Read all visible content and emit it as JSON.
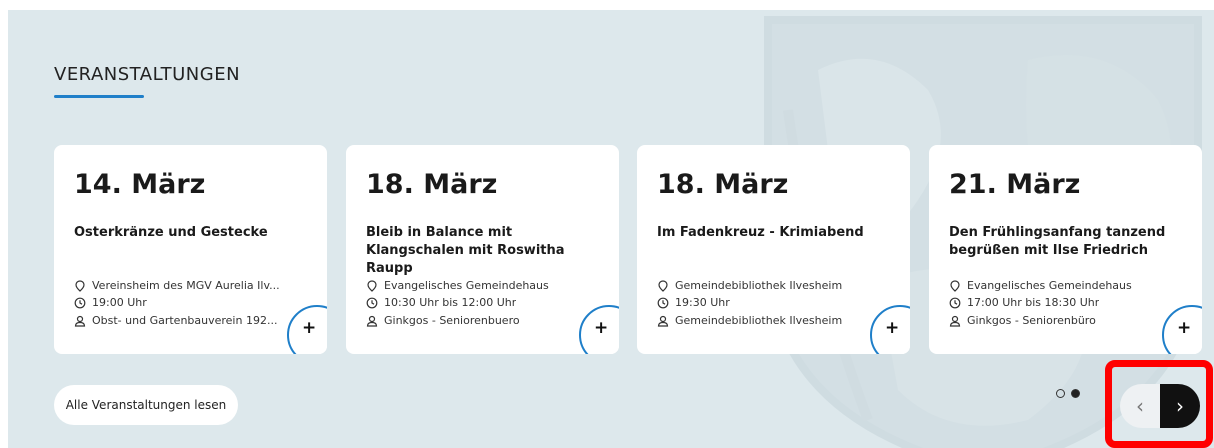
{
  "section": {
    "heading": "VERANSTALTUNGEN",
    "accent_color": "#1f7fc9"
  },
  "cards": [
    {
      "date": "14. März",
      "title": "Osterkränze und Gestecke",
      "location": "Vereinsheim des MGV Aurelia Ilv...",
      "time": "19:00 Uhr",
      "organizer": "Obst- und Gartenbauverein 192...",
      "action": "+"
    },
    {
      "date": "18. März",
      "title": "Bleib in Balance mit Klangschalen mit Roswitha Raupp",
      "location": "Evangelisches Gemeindehaus",
      "time": "10:30 Uhr bis 12:00 Uhr",
      "organizer": "Ginkgos - Seniorenbuero",
      "action": "+"
    },
    {
      "date": "18. März",
      "title": "Im Fadenkreuz - Krimiabend",
      "location": "Gemeindebibliothek Ilvesheim",
      "time": "19:30 Uhr",
      "organizer": "Gemeindebibliothek Ilvesheim",
      "action": "+"
    },
    {
      "date": "21. März",
      "title": "Den Frühlingsanfang tanzend begrüßen mit Ilse Friedrich",
      "location": "Evangelisches Gemeindehaus",
      "time": "17:00 Uhr bis 18:30 Uhr",
      "organizer": "Ginkgos - Seniorenbüro",
      "action": "+"
    }
  ],
  "footer": {
    "all_events_label": "Alle Veranstaltungen lesen"
  },
  "pagination": {
    "pages": 2,
    "active_page": 2
  },
  "carousel_nav": {
    "prev_glyph": "‹",
    "next_glyph": "›",
    "highlight_color": "#ff0000"
  }
}
